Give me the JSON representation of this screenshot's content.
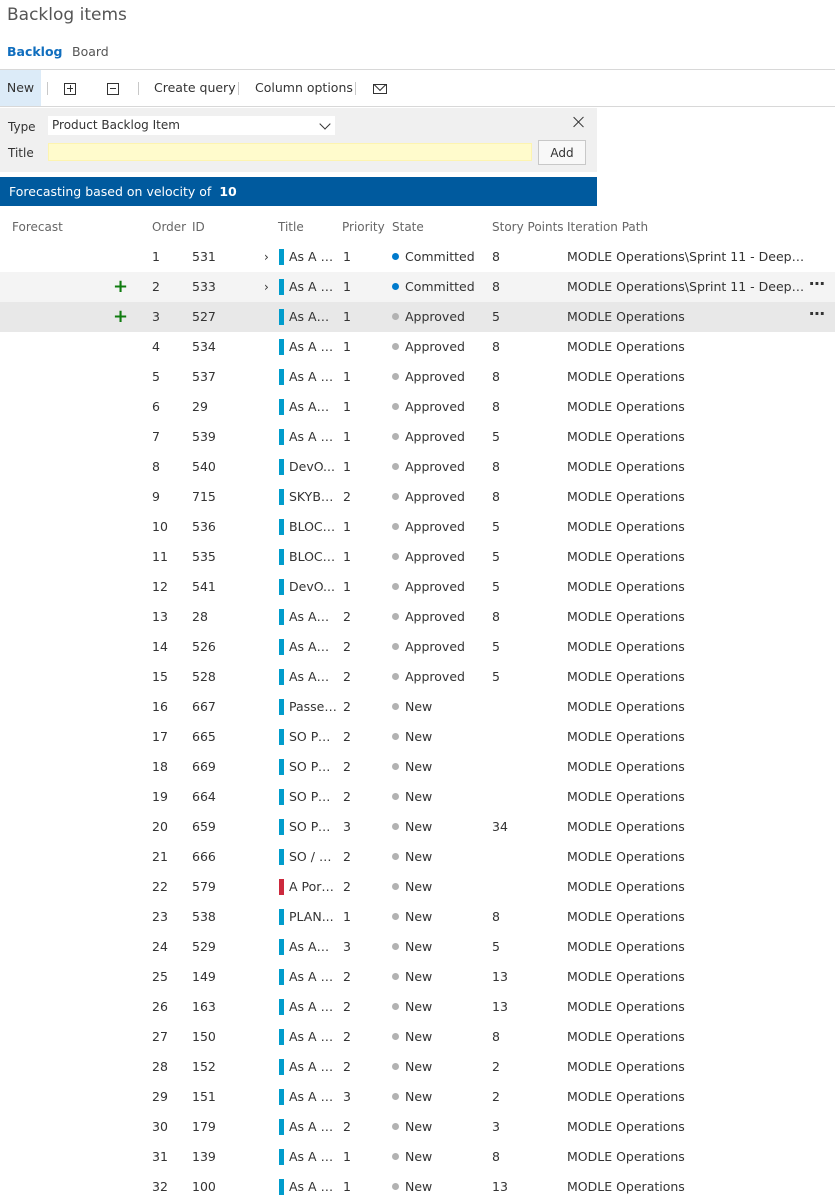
{
  "page_title": "Backlog items",
  "pivots": {
    "backlog": "Backlog",
    "board": "Board"
  },
  "toolbar": {
    "new_label": "New",
    "create_query": "Create query",
    "column_options": "Column options"
  },
  "add_panel": {
    "type_label": "Type",
    "type_value": "Product Backlog Item",
    "title_label": "Title",
    "title_value": "",
    "add_button": "Add"
  },
  "forecast": {
    "label": "Forecasting based on velocity of",
    "velocity": "10"
  },
  "columns": {
    "forecast": "Forecast",
    "order": "Order",
    "id": "ID",
    "title": "Title",
    "priority": "Priority",
    "state": "State",
    "story_points": "Story Points",
    "iteration_path": "Iteration Path"
  },
  "colors": {
    "pbi": "#009ccc",
    "bug": "#cc293d",
    "committed": "#007acc",
    "approved": "#b2b2b2",
    "forecast_bar": "#005a9e"
  },
  "rows": [
    {
      "order": "1",
      "id": "531",
      "title": "As A S...",
      "priority": "1",
      "state": "Committed",
      "points": "8",
      "iteration": "MODLE Operations\\Sprint 11 - Deep Dish",
      "expand": true
    },
    {
      "order": "2",
      "id": "533",
      "title": "As A S...",
      "priority": "1",
      "state": "Committed",
      "points": "8",
      "iteration": "MODLE Operations\\Sprint 11 - Deep Di...",
      "expand": true,
      "plus": true,
      "more": true,
      "hover": true
    },
    {
      "order": "3",
      "id": "527",
      "title": "As An ...",
      "priority": "1",
      "state": "Approved",
      "points": "5",
      "iteration": "MODLE Operations",
      "plus": true,
      "more": true,
      "selected": true
    },
    {
      "order": "4",
      "id": "534",
      "title": "As A S...",
      "priority": "1",
      "state": "Approved",
      "points": "8",
      "iteration": "MODLE Operations"
    },
    {
      "order": "5",
      "id": "537",
      "title": "As A S...",
      "priority": "1",
      "state": "Approved",
      "points": "8",
      "iteration": "MODLE Operations"
    },
    {
      "order": "6",
      "id": "29",
      "title": "As An ...",
      "priority": "1",
      "state": "Approved",
      "points": "8",
      "iteration": "MODLE Operations"
    },
    {
      "order": "7",
      "id": "539",
      "title": "As A P...",
      "priority": "1",
      "state": "Approved",
      "points": "5",
      "iteration": "MODLE Operations"
    },
    {
      "order": "8",
      "id": "540",
      "title": "DevO...",
      "priority": "1",
      "state": "Approved",
      "points": "8",
      "iteration": "MODLE Operations"
    },
    {
      "order": "9",
      "id": "715",
      "title": "SKYBU...",
      "priority": "2",
      "state": "Approved",
      "points": "8",
      "iteration": "MODLE Operations"
    },
    {
      "order": "10",
      "id": "536",
      "title": "BLOCK...",
      "priority": "1",
      "state": "Approved",
      "points": "5",
      "iteration": "MODLE Operations"
    },
    {
      "order": "11",
      "id": "535",
      "title": "BLOCK...",
      "priority": "1",
      "state": "Approved",
      "points": "5",
      "iteration": "MODLE Operations"
    },
    {
      "order": "12",
      "id": "541",
      "title": "DevO...",
      "priority": "1",
      "state": "Approved",
      "points": "5",
      "iteration": "MODLE Operations"
    },
    {
      "order": "13",
      "id": "28",
      "title": "As An ...",
      "priority": "2",
      "state": "Approved",
      "points": "8",
      "iteration": "MODLE Operations"
    },
    {
      "order": "14",
      "id": "526",
      "title": "As An ...",
      "priority": "2",
      "state": "Approved",
      "points": "5",
      "iteration": "MODLE Operations"
    },
    {
      "order": "15",
      "id": "528",
      "title": "As An ...",
      "priority": "2",
      "state": "Approved",
      "points": "5",
      "iteration": "MODLE Operations"
    },
    {
      "order": "16",
      "id": "667",
      "title": "Passen...",
      "priority": "2",
      "state": "New",
      "points": "",
      "iteration": "MODLE Operations"
    },
    {
      "order": "17",
      "id": "665",
      "title": "SO Po...",
      "priority": "2",
      "state": "New",
      "points": "",
      "iteration": "MODLE Operations"
    },
    {
      "order": "18",
      "id": "669",
      "title": "SO Po...",
      "priority": "2",
      "state": "New",
      "points": "",
      "iteration": "MODLE Operations"
    },
    {
      "order": "19",
      "id": "664",
      "title": "SO Po...",
      "priority": "2",
      "state": "New",
      "points": "",
      "iteration": "MODLE Operations"
    },
    {
      "order": "20",
      "id": "659",
      "title": "SO Po...",
      "priority": "3",
      "state": "New",
      "points": "34",
      "iteration": "MODLE Operations"
    },
    {
      "order": "21",
      "id": "666",
      "title": "SO / E...",
      "priority": "2",
      "state": "New",
      "points": "",
      "iteration": "MODLE Operations"
    },
    {
      "order": "22",
      "id": "579",
      "title": "A Port...",
      "priority": "2",
      "state": "New",
      "points": "",
      "iteration": "MODLE Operations",
      "bug": true
    },
    {
      "order": "23",
      "id": "538",
      "title": "PLAN...",
      "priority": "1",
      "state": "New",
      "points": "8",
      "iteration": "MODLE Operations"
    },
    {
      "order": "24",
      "id": "529",
      "title": "As An ...",
      "priority": "3",
      "state": "New",
      "points": "5",
      "iteration": "MODLE Operations"
    },
    {
      "order": "25",
      "id": "149",
      "title": "As A P...",
      "priority": "2",
      "state": "New",
      "points": "13",
      "iteration": "MODLE Operations"
    },
    {
      "order": "26",
      "id": "163",
      "title": "As A P...",
      "priority": "2",
      "state": "New",
      "points": "13",
      "iteration": "MODLE Operations"
    },
    {
      "order": "27",
      "id": "150",
      "title": "As A P...",
      "priority": "2",
      "state": "New",
      "points": "8",
      "iteration": "MODLE Operations"
    },
    {
      "order": "28",
      "id": "152",
      "title": "As A P...",
      "priority": "2",
      "state": "New",
      "points": "2",
      "iteration": "MODLE Operations"
    },
    {
      "order": "29",
      "id": "151",
      "title": "As A P...",
      "priority": "3",
      "state": "New",
      "points": "2",
      "iteration": "MODLE Operations"
    },
    {
      "order": "30",
      "id": "179",
      "title": "As A P...",
      "priority": "2",
      "state": "New",
      "points": "3",
      "iteration": "MODLE Operations"
    },
    {
      "order": "31",
      "id": "139",
      "title": "As A S...",
      "priority": "1",
      "state": "New",
      "points": "8",
      "iteration": "MODLE Operations"
    },
    {
      "order": "32",
      "id": "100",
      "title": "As A S...",
      "priority": "1",
      "state": "New",
      "points": "13",
      "iteration": "MODLE Operations"
    }
  ]
}
